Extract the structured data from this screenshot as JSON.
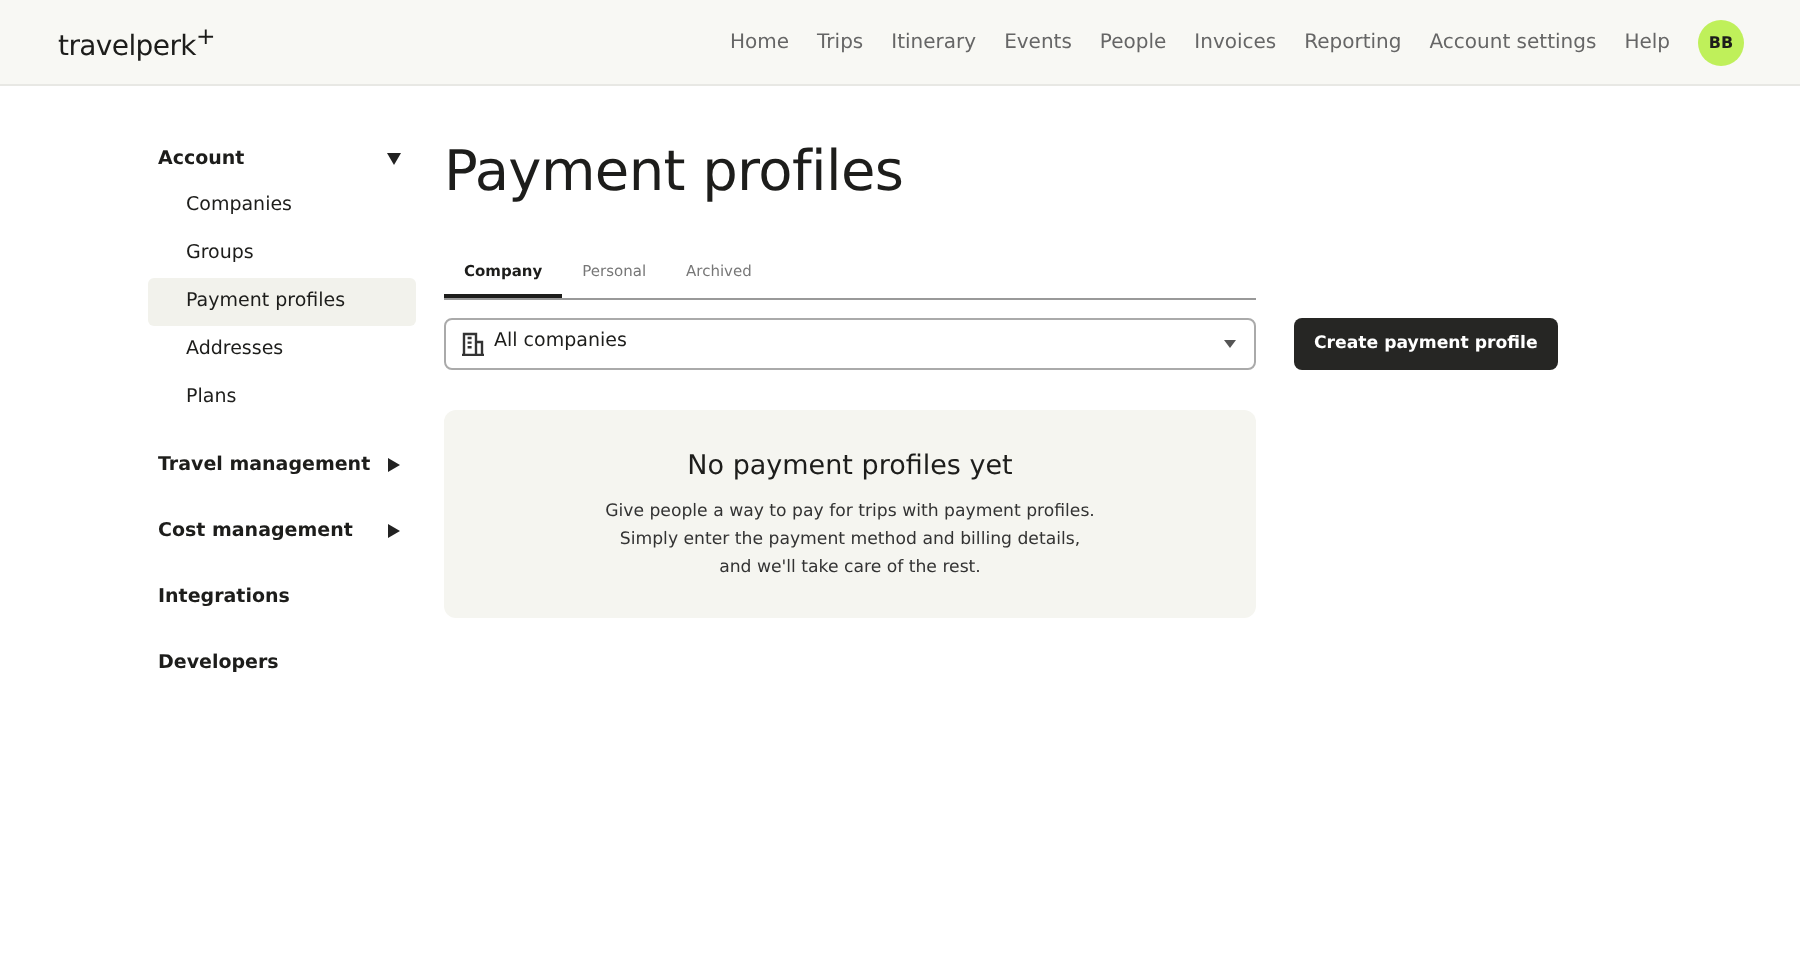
{
  "header": {
    "logo": "travelperk$^{+}$",
    "nav": [
      "Home",
      "Trips",
      "Itinerary",
      "Events",
      "People",
      "Invoices",
      "Reporting",
      "Account settings",
      "Help"
    ],
    "avatar": "BB"
  },
  "sidebar": {
    "items": [
      {
        "label": "Account",
        "kind": "group",
        "expanded": true,
        "children": [
          {
            "label": "Companies",
            "selected": false
          },
          {
            "label": "Groups",
            "selected": false
          },
          {
            "label": "Payment profiles",
            "selected": true
          },
          {
            "label": "Addresses",
            "selected": false
          },
          {
            "label": "Plans",
            "selected": false
          }
        ]
      },
      {
        "label": "Travel management",
        "kind": "group",
        "expanded": false
      },
      {
        "label": "Cost management",
        "kind": "group",
        "expanded": false
      },
      {
        "label": "Integrations",
        "kind": "link"
      },
      {
        "label": "Developers",
        "kind": "link"
      }
    ]
  },
  "page": {
    "title": "Payment profiles",
    "tabs": [
      {
        "label": "Company",
        "selected": true
      },
      {
        "label": "Personal",
        "selected": false
      },
      {
        "label": "Archived",
        "selected": false
      }
    ],
    "filter": {
      "value": "All companies"
    },
    "create_button": "Create payment profile",
    "empty_state": {
      "title": "No payment profiles yet",
      "lines": [
        "Give people a way to pay for trips with payment profiles.",
        "Simply enter the payment method and billing details,",
        "and we'll take care of the rest."
      ]
    }
  }
}
